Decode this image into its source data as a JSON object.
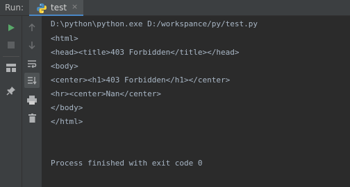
{
  "header": {
    "run_label": "Run:",
    "tab": {
      "label": "test",
      "close_glyph": "×",
      "icon": "python-icon"
    }
  },
  "toolbar_left": [
    "run-icon",
    "stop-icon",
    "layout-icon",
    "pin-icon"
  ],
  "toolbar_mid": [
    "up-arrow-icon",
    "down-arrow-icon",
    "soft-wrap-icon",
    "scroll-to-end-icon",
    "print-icon",
    "trash-icon"
  ],
  "console": {
    "lines": [
      "D:\\python\\python.exe D:/workspance/py/test.py",
      "<html>",
      "<head><title>403 Forbidden</title></head>",
      "<body>",
      "<center><h1>403 Forbidden</h1></center>",
      "<hr><center>Nan</center>",
      "</body>",
      "</html>",
      "Process finished with exit code 0"
    ]
  },
  "colors": {
    "panel": "#3c3f41",
    "console_bg": "#2b2b2b",
    "text": "#a9b7c6",
    "run_green": "#59a869",
    "tab_accent": "#4a88c7"
  }
}
